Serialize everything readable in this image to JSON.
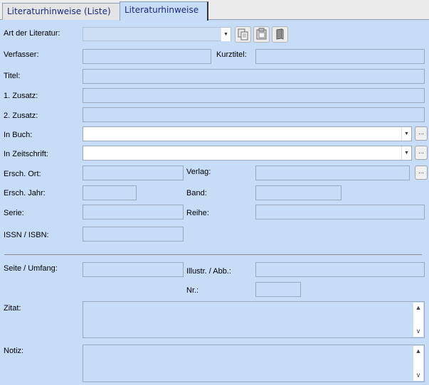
{
  "tabs": [
    {
      "label": "Literaturhinweise (Liste)"
    },
    {
      "label": "Literaturhinweise"
    }
  ],
  "form": {
    "art_label": "Art der Literatur:",
    "verfasser_label": "Verfasser:",
    "kurztitel_label": "Kurztitel:",
    "titel_label": "Titel:",
    "zusatz1_label": "1. Zusatz:",
    "zusatz2_label": "2. Zusatz:",
    "inbuch_label": "In Buch:",
    "zeitschrift_label": "In Zeitschrift:",
    "ort_label": "Ersch. Ort:",
    "verlag_label": "Verlag:",
    "jahr_label": "Ersch. Jahr:",
    "band_label": "Band:",
    "serie_label": "Serie:",
    "reihe_label": "Reihe:",
    "issn_label": "ISSN / ISBN:",
    "seite_label": "Seite / Umfang:",
    "illustr_label": "Illustr. / Abb.:",
    "nr_label": "Nr.:",
    "zitat_label": "Zitat:",
    "notiz_label": "Notiz:"
  },
  "buttons": {
    "ellipsis": "...",
    "dropdown_arrow": "▼",
    "scroll_up": "▲",
    "scroll_down": "∨"
  },
  "icons": [
    "copy-icon",
    "paste-icon",
    "book-icon"
  ]
}
